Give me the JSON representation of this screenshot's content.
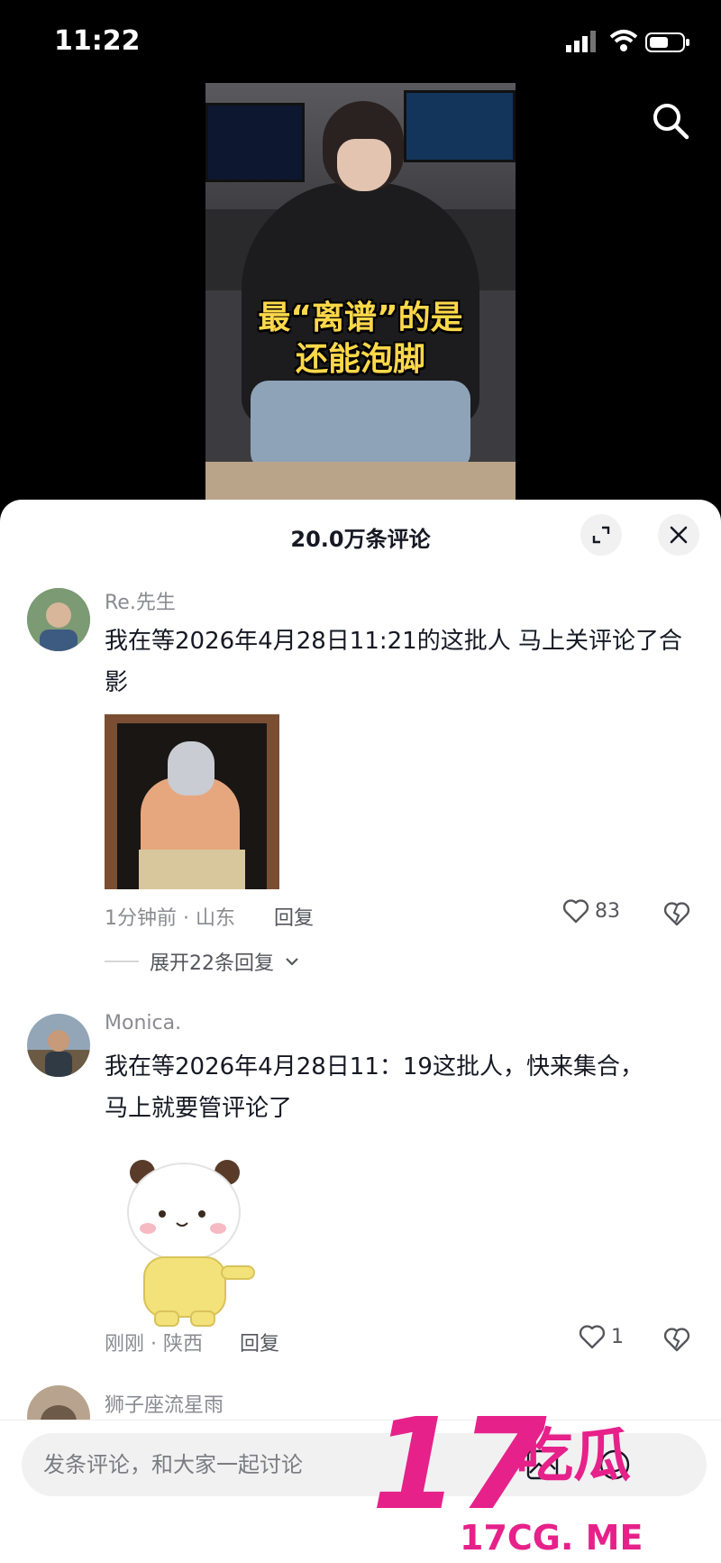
{
  "status_bar": {
    "time": "11:22"
  },
  "video": {
    "caption_line1": "最“离谱”的是",
    "caption_line2": "还能泡脚"
  },
  "comments_panel": {
    "title": "20.0万条评论",
    "comments": [
      {
        "username": "Re.先生",
        "text": "我在等2026年4月28日11:21的这批人 马上关评论了合影",
        "meta": "1分钟前 · 山东",
        "reply_label": "回复",
        "likes": "83",
        "expand_label": "展开22条回复"
      },
      {
        "username": "Monica.",
        "text": "我在等2026年4月28日11：19这批人，快来集合，马上就要管评论了",
        "meta": "刚刚 · 陕西",
        "reply_label": "回复",
        "likes": "1"
      },
      {
        "username": "狮子座流星雨"
      }
    ]
  },
  "input": {
    "placeholder": "发条评论，和大家一起讨论"
  },
  "watermark": {
    "brand": "17吃瓜",
    "domain": "17CG. ME"
  },
  "colors": {
    "accent": "#e6218a",
    "text": "#161823",
    "muted": "#8a8b91"
  }
}
